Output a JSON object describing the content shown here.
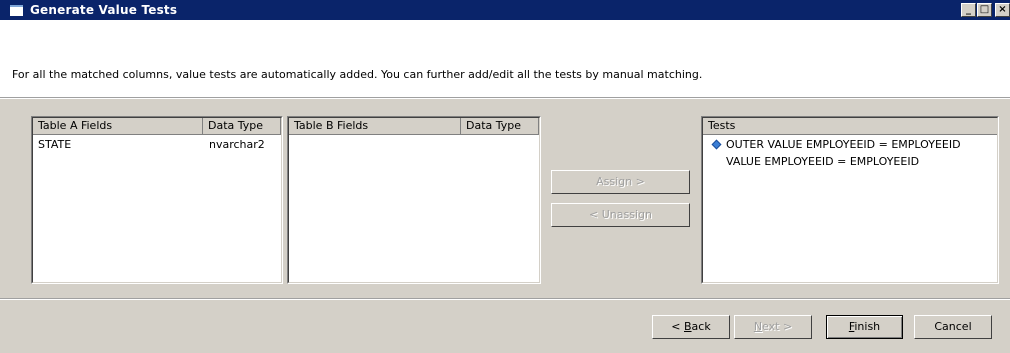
{
  "window": {
    "title": "Generate Value Tests",
    "minimize_glyph": "_",
    "maximize_glyph": "□",
    "close_glyph": "×"
  },
  "header": {
    "description": "For all the matched columns, value tests are automatically added. You can further add/edit all the tests by manual matching."
  },
  "table_a": {
    "columns": [
      "Table A Fields",
      "Data Type"
    ],
    "rows": [
      {
        "field": "STATE",
        "type": "nvarchar2"
      }
    ]
  },
  "table_b": {
    "columns": [
      "Table B Fields",
      "Data Type"
    ],
    "rows": []
  },
  "actions": {
    "assign_label": "Assign >",
    "unassign_label": "< Unassign"
  },
  "tests": {
    "header": "Tests",
    "items": [
      {
        "label": "OUTER VALUE EMPLOYEEID = EMPLOYEEID",
        "icon": "diamond-icon"
      },
      {
        "label": "VALUE EMPLOYEEID = EMPLOYEEID",
        "icon": ""
      }
    ]
  },
  "footer": {
    "back_pre": "< ",
    "back_acc": "B",
    "back_rest": "ack",
    "next_acc": "N",
    "next_rest": "ext >",
    "finish_acc": "F",
    "finish_rest": "inish",
    "cancel_label": "Cancel"
  },
  "colors": {
    "titlebar": "#0a246a",
    "face": "#d4d0c8",
    "icon_blue": "#3b7fd6"
  }
}
